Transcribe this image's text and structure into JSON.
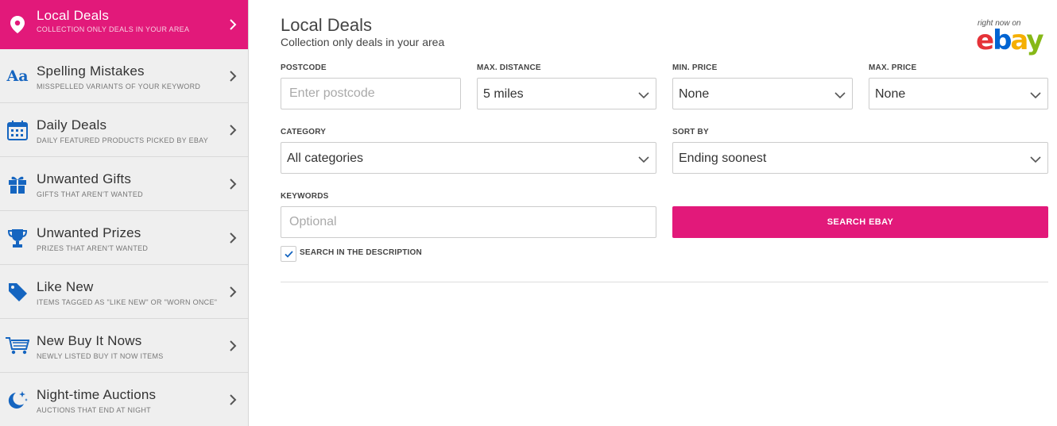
{
  "sidebar": {
    "items": [
      {
        "title": "Local Deals",
        "subtitle": "COLLECTION ONLY DEALS IN YOUR AREA",
        "icon": "map-pin-icon"
      },
      {
        "title": "Spelling Mistakes",
        "subtitle": "MISSPELLED VARIANTS OF YOUR KEYWORD",
        "icon": "text-aa-icon"
      },
      {
        "title": "Daily Deals",
        "subtitle": "DAILY FEATURED PRODUCTS PICKED BY EBAY",
        "icon": "calendar-icon"
      },
      {
        "title": "Unwanted Gifts",
        "subtitle": "GIFTS THAT AREN'T WANTED",
        "icon": "gift-icon"
      },
      {
        "title": "Unwanted Prizes",
        "subtitle": "PRIZES THAT AREN'T WANTED",
        "icon": "trophy-icon"
      },
      {
        "title": "Like New",
        "subtitle": "ITEMS TAGGED AS \"LIKE NEW\" OR \"WORN ONCE\"",
        "icon": "tag-icon"
      },
      {
        "title": "New Buy It Nows",
        "subtitle": "NEWLY LISTED BUY IT NOW ITEMS",
        "icon": "cart-icon"
      },
      {
        "title": "Night-time Auctions",
        "subtitle": "AUCTIONS THAT END AT NIGHT",
        "icon": "moon-stars-icon"
      }
    ]
  },
  "main": {
    "title": "Local Deals",
    "subtitle": "Collection only deals in your area",
    "logo": {
      "tagline": "right now on",
      "brand": "ebay"
    },
    "postcode": {
      "label": "POSTCODE",
      "placeholder": "Enter postcode",
      "value": ""
    },
    "max_distance": {
      "label": "MAX. DISTANCE",
      "value": "5 miles"
    },
    "min_price": {
      "label": "MIN. PRICE",
      "value": "None"
    },
    "max_price": {
      "label": "MAX. PRICE",
      "value": "None"
    },
    "category": {
      "label": "CATEGORY",
      "value": "All categories"
    },
    "sort_by": {
      "label": "SORT BY",
      "value": "Ending soonest"
    },
    "keywords": {
      "label": "KEYWORDS",
      "placeholder": "Optional",
      "value": ""
    },
    "search_button": "SEARCH EBAY",
    "search_description": {
      "label": "SEARCH IN THE DESCRIPTION",
      "checked": true
    }
  },
  "colors": {
    "accent": "#e2197a",
    "icon_blue": "#1565c0",
    "sidebar_bg": "#efefef"
  }
}
